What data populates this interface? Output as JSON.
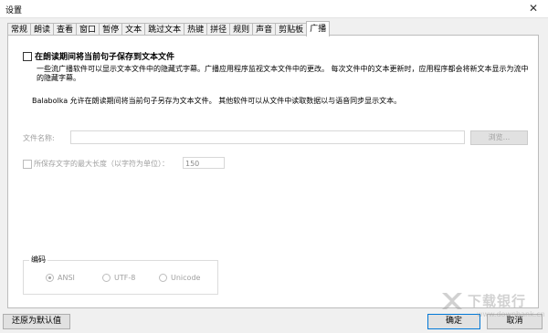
{
  "window": {
    "title": "设置",
    "close_glyph": "✕"
  },
  "tabs": [
    "常规",
    "朗读",
    "查看",
    "窗口",
    "暂停",
    "文本",
    "跳过文本",
    "热键",
    "拼径",
    "规则",
    "声音",
    "剪贴板",
    "广播"
  ],
  "active_tab": "广播",
  "broadcast": {
    "save_checkbox_label": "在朗读期间将当前句子保存到文本文件",
    "description_1": "一些流广播软件可以显示文本文件中的隐藏式字幕。广播应用程序监视文本文件中的更改。 每次文件中的文本更新时，应用程序都会将新文本显示为流中的隐藏字幕。",
    "description_2": "Balabolka 允许在朗读期间将当前句子另存为文本文件。 其他软件可以从文件中读取数据以与语音同步显示文本。",
    "filename_label": "文件名称:",
    "filename_value": "",
    "browse_label": "浏览...",
    "maxlen_label": "所保存文字的最大长度（以字符为单位）：",
    "maxlen_value": "150",
    "encoding_legend": "编码",
    "encoding_options": [
      "ANSI",
      "UTF-8",
      "Unicode"
    ],
    "encoding_selected": "ANSI"
  },
  "footer": {
    "reset_label": "还原为默认值",
    "ok_label": "确定",
    "cancel_label": "取消"
  },
  "watermark": {
    "text": "下载银行",
    "sub": "www.downbank.cn"
  }
}
